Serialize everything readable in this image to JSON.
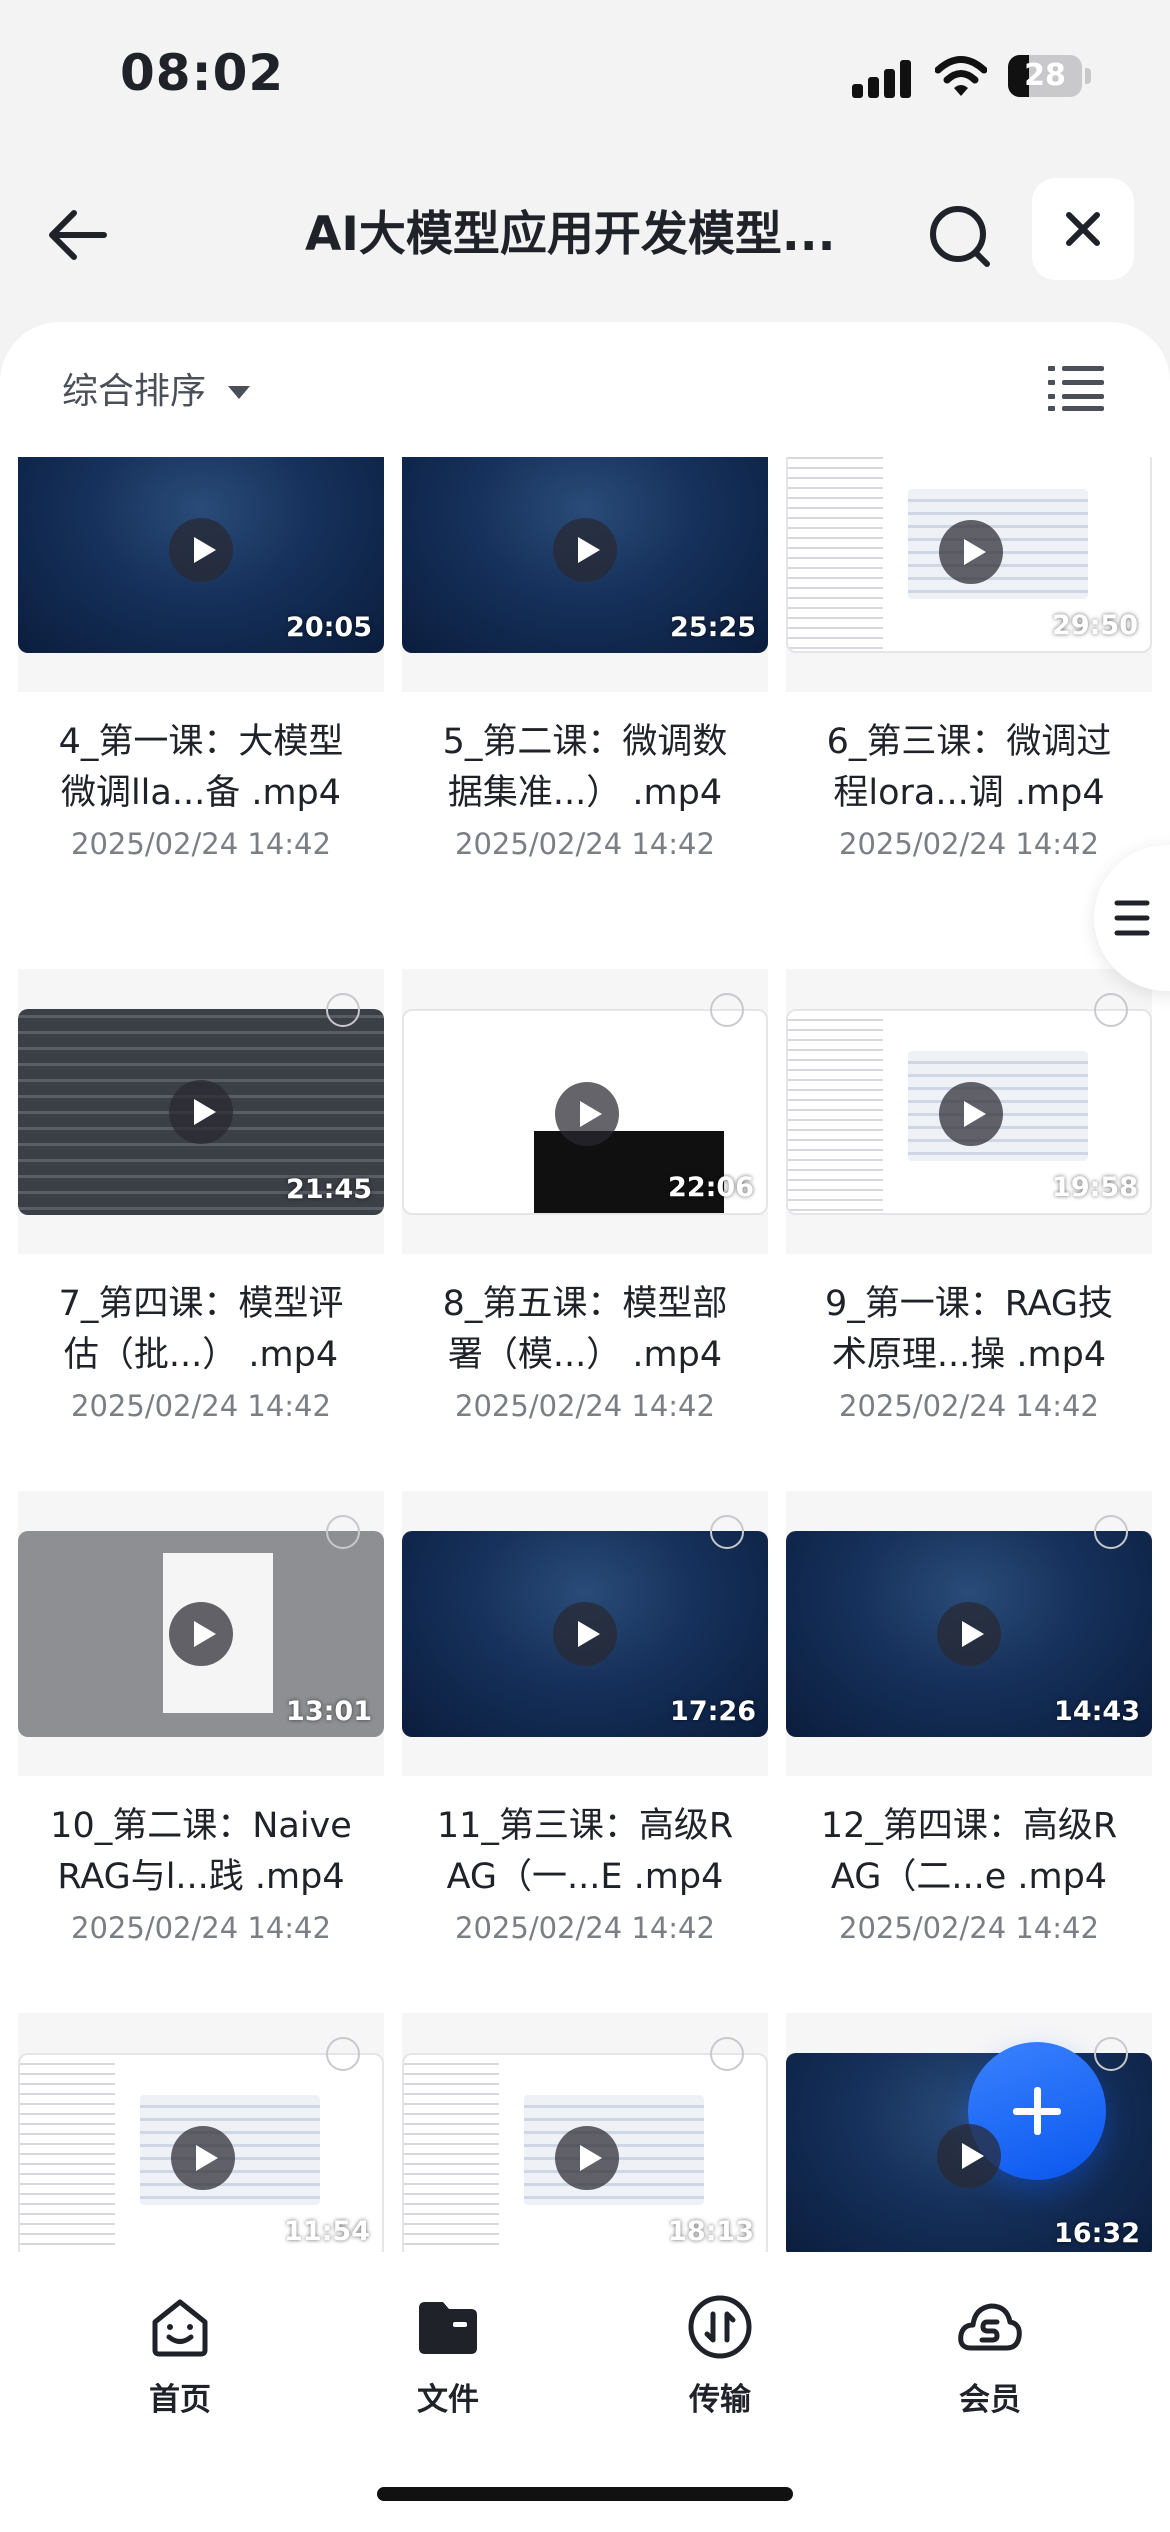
{
  "status_bar": {
    "time": "08:02",
    "battery": "28"
  },
  "header": {
    "title": "AI大模型应用开发模型..."
  },
  "toolbar": {
    "sort_label": "综合排序"
  },
  "files": [
    {
      "name_line1": "4_第一课：大模型",
      "name_line2": "微调lla...备 .mp4",
      "date": "2025/02/24 14:42",
      "duration": "20:05",
      "thumb": "dark"
    },
    {
      "name_line1": "5_第二课：微调数",
      "name_line2": "据集准...） .mp4",
      "date": "2025/02/24 14:42",
      "duration": "25:25",
      "thumb": "dark"
    },
    {
      "name_line1": "6_第三课：微调过",
      "name_line2": "程lora...调 .mp4",
      "date": "2025/02/24 14:42",
      "duration": "29:50",
      "thumb": "doc"
    },
    {
      "name_line1": "7_第四课：模型评",
      "name_line2": "估（批...） .mp4",
      "date": "2025/02/24 14:42",
      "duration": "21:45",
      "thumb": "terminal"
    },
    {
      "name_line1": "8_第五课：模型部",
      "name_line2": "署（模...） .mp4",
      "date": "2025/02/24 14:42",
      "duration": "22:06",
      "thumb": "termdoc"
    },
    {
      "name_line1": "9_第一课：RAG技",
      "name_line2": "术原理...操 .mp4",
      "date": "2025/02/24 14:42",
      "duration": "19:58",
      "thumb": "doc"
    },
    {
      "name_line1": "10_第二课：Naive",
      "name_line2": "RAG与l...践 .mp4",
      "date": "2025/02/24 14:42",
      "duration": "13:01",
      "thumb": "gray"
    },
    {
      "name_line1": "11_第三课：高级R",
      "name_line2": "AG（一...E .mp4",
      "date": "2025/02/24 14:42",
      "duration": "17:26",
      "thumb": "dark"
    },
    {
      "name_line1": "12_第四课：高级R",
      "name_line2": "AG（二...e .mp4",
      "date": "2025/02/24 14:42",
      "duration": "14:43",
      "thumb": "dark"
    },
    {
      "name_line1": "",
      "name_line2": "",
      "date": "",
      "duration": "11:54",
      "thumb": "doc"
    },
    {
      "name_line1": "",
      "name_line2": "",
      "date": "",
      "duration": "18:13",
      "thumb": "doc"
    },
    {
      "name_line1": "",
      "name_line2": "",
      "date": "",
      "duration": "16:32",
      "thumb": "dark"
    }
  ],
  "tabbar": {
    "home": "首页",
    "files": "文件",
    "transfer": "传输",
    "member": "会员"
  },
  "colors": {
    "accent": "#0f62fe",
    "text": "#1f2329",
    "muted": "#7a7e85"
  },
  "icons": [
    "back-arrow-icon",
    "search-icon",
    "close-icon",
    "list-view-icon",
    "play-icon",
    "menu-icon",
    "plus-icon",
    "home-icon",
    "folder-icon",
    "transfer-icon",
    "member-icon"
  ]
}
